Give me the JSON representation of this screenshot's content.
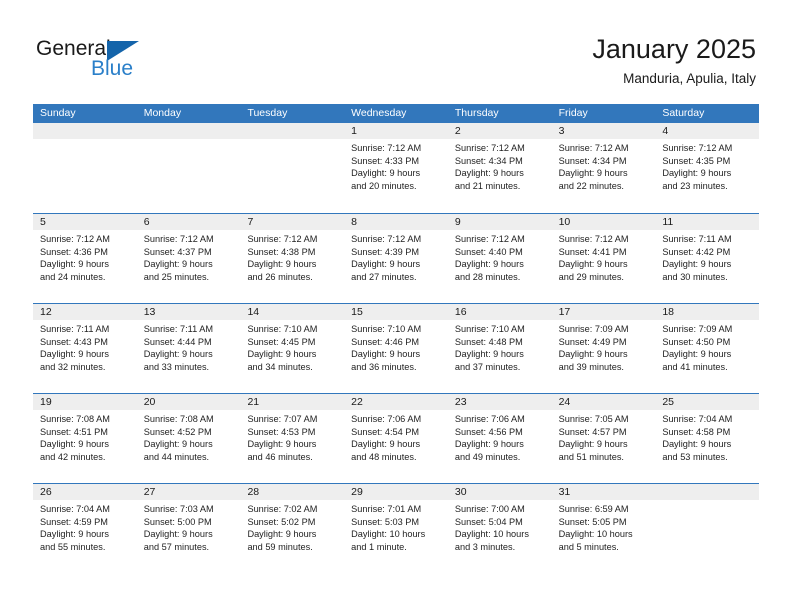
{
  "brand": {
    "name_part1": "General",
    "name_part2": "Blue",
    "triangle_color": "#1464aa",
    "blue_color": "#2a7fc9"
  },
  "header": {
    "title": "January 2025",
    "subtitle": "Manduria, Apulia, Italy"
  },
  "theme": {
    "header_bar_color": "#3277bc",
    "daynum_bar_color": "#eeeeee",
    "text_color": "#1a1a1a"
  },
  "weekdays": [
    "Sunday",
    "Monday",
    "Tuesday",
    "Wednesday",
    "Thursday",
    "Friday",
    "Saturday"
  ],
  "weeks": [
    [
      {
        "day": "",
        "empty": true
      },
      {
        "day": "",
        "empty": true
      },
      {
        "day": "",
        "empty": true
      },
      {
        "day": "1",
        "sunrise": "Sunrise: 7:12 AM",
        "sunset": "Sunset: 4:33 PM",
        "daylight1": "Daylight: 9 hours",
        "daylight2": "and 20 minutes."
      },
      {
        "day": "2",
        "sunrise": "Sunrise: 7:12 AM",
        "sunset": "Sunset: 4:34 PM",
        "daylight1": "Daylight: 9 hours",
        "daylight2": "and 21 minutes."
      },
      {
        "day": "3",
        "sunrise": "Sunrise: 7:12 AM",
        "sunset": "Sunset: 4:34 PM",
        "daylight1": "Daylight: 9 hours",
        "daylight2": "and 22 minutes."
      },
      {
        "day": "4",
        "sunrise": "Sunrise: 7:12 AM",
        "sunset": "Sunset: 4:35 PM",
        "daylight1": "Daylight: 9 hours",
        "daylight2": "and 23 minutes."
      }
    ],
    [
      {
        "day": "5",
        "sunrise": "Sunrise: 7:12 AM",
        "sunset": "Sunset: 4:36 PM",
        "daylight1": "Daylight: 9 hours",
        "daylight2": "and 24 minutes."
      },
      {
        "day": "6",
        "sunrise": "Sunrise: 7:12 AM",
        "sunset": "Sunset: 4:37 PM",
        "daylight1": "Daylight: 9 hours",
        "daylight2": "and 25 minutes."
      },
      {
        "day": "7",
        "sunrise": "Sunrise: 7:12 AM",
        "sunset": "Sunset: 4:38 PM",
        "daylight1": "Daylight: 9 hours",
        "daylight2": "and 26 minutes."
      },
      {
        "day": "8",
        "sunrise": "Sunrise: 7:12 AM",
        "sunset": "Sunset: 4:39 PM",
        "daylight1": "Daylight: 9 hours",
        "daylight2": "and 27 minutes."
      },
      {
        "day": "9",
        "sunrise": "Sunrise: 7:12 AM",
        "sunset": "Sunset: 4:40 PM",
        "daylight1": "Daylight: 9 hours",
        "daylight2": "and 28 minutes."
      },
      {
        "day": "10",
        "sunrise": "Sunrise: 7:12 AM",
        "sunset": "Sunset: 4:41 PM",
        "daylight1": "Daylight: 9 hours",
        "daylight2": "and 29 minutes."
      },
      {
        "day": "11",
        "sunrise": "Sunrise: 7:11 AM",
        "sunset": "Sunset: 4:42 PM",
        "daylight1": "Daylight: 9 hours",
        "daylight2": "and 30 minutes."
      }
    ],
    [
      {
        "day": "12",
        "sunrise": "Sunrise: 7:11 AM",
        "sunset": "Sunset: 4:43 PM",
        "daylight1": "Daylight: 9 hours",
        "daylight2": "and 32 minutes."
      },
      {
        "day": "13",
        "sunrise": "Sunrise: 7:11 AM",
        "sunset": "Sunset: 4:44 PM",
        "daylight1": "Daylight: 9 hours",
        "daylight2": "and 33 minutes."
      },
      {
        "day": "14",
        "sunrise": "Sunrise: 7:10 AM",
        "sunset": "Sunset: 4:45 PM",
        "daylight1": "Daylight: 9 hours",
        "daylight2": "and 34 minutes."
      },
      {
        "day": "15",
        "sunrise": "Sunrise: 7:10 AM",
        "sunset": "Sunset: 4:46 PM",
        "daylight1": "Daylight: 9 hours",
        "daylight2": "and 36 minutes."
      },
      {
        "day": "16",
        "sunrise": "Sunrise: 7:10 AM",
        "sunset": "Sunset: 4:48 PM",
        "daylight1": "Daylight: 9 hours",
        "daylight2": "and 37 minutes."
      },
      {
        "day": "17",
        "sunrise": "Sunrise: 7:09 AM",
        "sunset": "Sunset: 4:49 PM",
        "daylight1": "Daylight: 9 hours",
        "daylight2": "and 39 minutes."
      },
      {
        "day": "18",
        "sunrise": "Sunrise: 7:09 AM",
        "sunset": "Sunset: 4:50 PM",
        "daylight1": "Daylight: 9 hours",
        "daylight2": "and 41 minutes."
      }
    ],
    [
      {
        "day": "19",
        "sunrise": "Sunrise: 7:08 AM",
        "sunset": "Sunset: 4:51 PM",
        "daylight1": "Daylight: 9 hours",
        "daylight2": "and 42 minutes."
      },
      {
        "day": "20",
        "sunrise": "Sunrise: 7:08 AM",
        "sunset": "Sunset: 4:52 PM",
        "daylight1": "Daylight: 9 hours",
        "daylight2": "and 44 minutes."
      },
      {
        "day": "21",
        "sunrise": "Sunrise: 7:07 AM",
        "sunset": "Sunset: 4:53 PM",
        "daylight1": "Daylight: 9 hours",
        "daylight2": "and 46 minutes."
      },
      {
        "day": "22",
        "sunrise": "Sunrise: 7:06 AM",
        "sunset": "Sunset: 4:54 PM",
        "daylight1": "Daylight: 9 hours",
        "daylight2": "and 48 minutes."
      },
      {
        "day": "23",
        "sunrise": "Sunrise: 7:06 AM",
        "sunset": "Sunset: 4:56 PM",
        "daylight1": "Daylight: 9 hours",
        "daylight2": "and 49 minutes."
      },
      {
        "day": "24",
        "sunrise": "Sunrise: 7:05 AM",
        "sunset": "Sunset: 4:57 PM",
        "daylight1": "Daylight: 9 hours",
        "daylight2": "and 51 minutes."
      },
      {
        "day": "25",
        "sunrise": "Sunrise: 7:04 AM",
        "sunset": "Sunset: 4:58 PM",
        "daylight1": "Daylight: 9 hours",
        "daylight2": "and 53 minutes."
      }
    ],
    [
      {
        "day": "26",
        "sunrise": "Sunrise: 7:04 AM",
        "sunset": "Sunset: 4:59 PM",
        "daylight1": "Daylight: 9 hours",
        "daylight2": "and 55 minutes."
      },
      {
        "day": "27",
        "sunrise": "Sunrise: 7:03 AM",
        "sunset": "Sunset: 5:00 PM",
        "daylight1": "Daylight: 9 hours",
        "daylight2": "and 57 minutes."
      },
      {
        "day": "28",
        "sunrise": "Sunrise: 7:02 AM",
        "sunset": "Sunset: 5:02 PM",
        "daylight1": "Daylight: 9 hours",
        "daylight2": "and 59 minutes."
      },
      {
        "day": "29",
        "sunrise": "Sunrise: 7:01 AM",
        "sunset": "Sunset: 5:03 PM",
        "daylight1": "Daylight: 10 hours",
        "daylight2": "and 1 minute."
      },
      {
        "day": "30",
        "sunrise": "Sunrise: 7:00 AM",
        "sunset": "Sunset: 5:04 PM",
        "daylight1": "Daylight: 10 hours",
        "daylight2": "and 3 minutes."
      },
      {
        "day": "31",
        "sunrise": "Sunrise: 6:59 AM",
        "sunset": "Sunset: 5:05 PM",
        "daylight1": "Daylight: 10 hours",
        "daylight2": "and 5 minutes."
      },
      {
        "day": "",
        "empty": true
      }
    ]
  ]
}
